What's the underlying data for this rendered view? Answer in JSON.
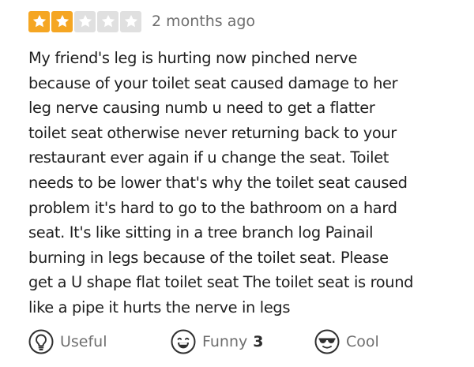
{
  "review": {
    "rating": 2,
    "max_rating": 5,
    "colors": {
      "star_filled_bg": "#f5a623",
      "star_empty_bg": "#e0e0e0",
      "star_glyph": "#ffffff",
      "text": "#1f1f1f",
      "muted": "#6e6e6e"
    },
    "date": "2 months ago",
    "text_lines": [
      "My friend's leg is hurting now pinched nerve",
      "because of your toilet seat caused damage to her",
      "leg nerve causing numb u need to get a flatter",
      "toilet seat otherwise never returning back to your",
      "restaurant ever again if u change the seat. Toilet",
      "needs to be lower that's why the toilet seat caused",
      "problem it's hard to go to the bathroom on a hard",
      "seat. It's like sitting in a tree branch log Painail",
      "burning in legs because of the toilet seat. Please",
      "get a U shape flat toilet seat The toilet seat is round",
      "like a pipe it hurts the nerve in legs"
    ]
  },
  "actions": {
    "useful": {
      "label": "Useful",
      "icon": "lightbulb-icon"
    },
    "funny": {
      "label": "Funny",
      "count": "3",
      "icon": "laughing-face-icon"
    },
    "cool": {
      "label": "Cool",
      "icon": "sunglasses-face-icon"
    }
  }
}
